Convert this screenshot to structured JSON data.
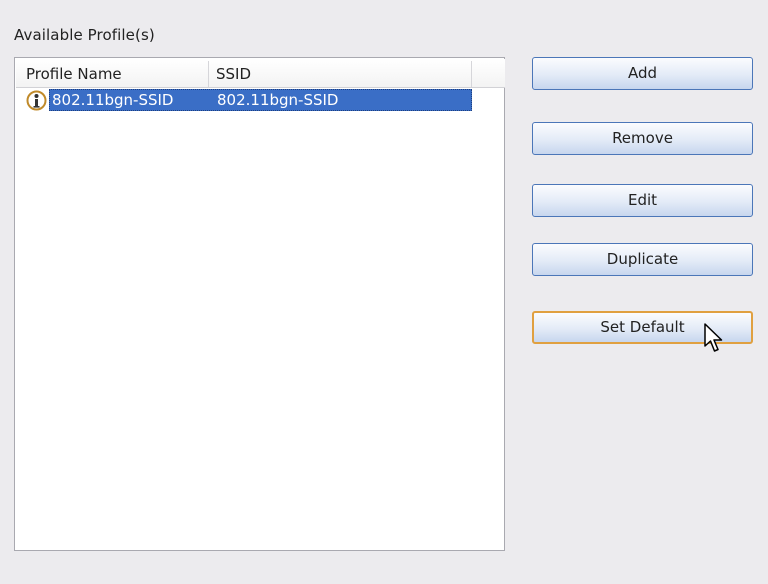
{
  "profiles_panel": {
    "section_label": "Available Profile(s)",
    "columns": [
      "Profile Name",
      "SSID"
    ],
    "rows": [
      {
        "profile_name": "802.11bgn-SSID",
        "ssid": "802.11bgn-SSID",
        "icon": "info-user-icon",
        "selected": true
      }
    ]
  },
  "buttons": {
    "add": "Add",
    "remove": "Remove",
    "edit": "Edit",
    "duplicate": "Duplicate",
    "set_default": "Set Default"
  },
  "colors": {
    "selection": "#3a6ec6",
    "focus_border": "#e0a040",
    "button_border": "#4b76b8"
  }
}
